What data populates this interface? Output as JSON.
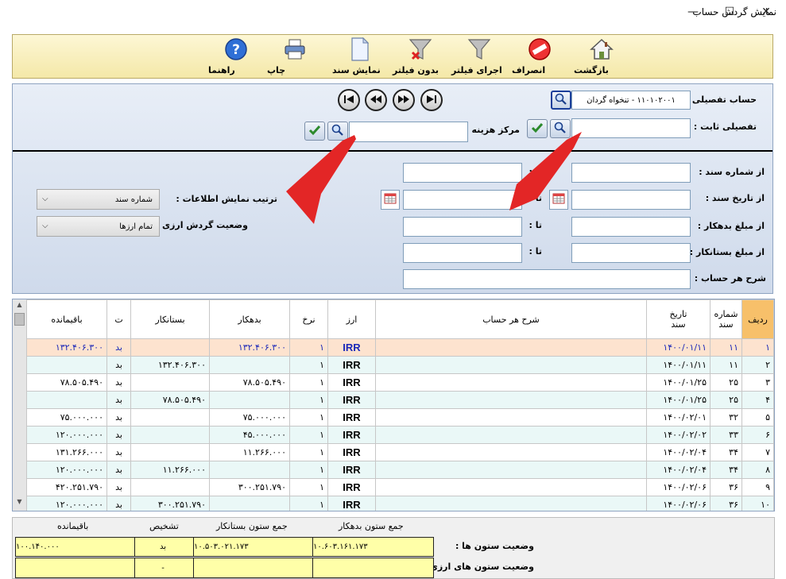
{
  "window": {
    "title": "نمایش گردش حساب",
    "minimize": "—",
    "maximize": "☐",
    "close": "✕"
  },
  "toolbar": {
    "back": "بازگشت",
    "cancel": "انصراف",
    "apply_filter": "اجرای فیلتر",
    "no_filter": "بدون فیلتر",
    "show_doc": "نمایش سند",
    "print": "چاپ",
    "help": "راهنما"
  },
  "filter": {
    "detail_account_label": "حساب تفصیلی :",
    "detail_account_value": "۱۱۰۱۰۲۰۰۱ - تنخواه گردان",
    "fixed_detail_label": "تفصیلی ثابت :",
    "fixed_detail_value": "",
    "cost_center_label": "مرکز هزینه :",
    "cost_center_value": "",
    "from_doc_no_label": "از شماره سند :",
    "from_doc_date_label": "از تاریخ سند :",
    "from_debit_label": "از مبلغ بدهکار :",
    "from_credit_label": "از مبلغ بستانکار :",
    "description_label": "شرح هر حساب :",
    "to_label": "تا :",
    "display_order_label": "ترتیب نمایش اطلاعات :",
    "display_order_value": "شماره سند",
    "currency_status_label": "وضعیت گردش ارزی :",
    "currency_status_value": "تمام ارزها"
  },
  "grid": {
    "headers": {
      "row": "ردیف",
      "doc_no_1": "شماره",
      "doc_no_2": "سند",
      "doc_date_1": "تاریخ",
      "doc_date_2": "سند",
      "description": "شرح هر حساب",
      "currency": "ارز",
      "rate": "نرخ",
      "debit": "بدهکار",
      "credit": "بستانکار",
      "diagnosis": "ت",
      "balance": "باقیمانده"
    },
    "rows": [
      {
        "row": "۱",
        "doc_no": "۱۱",
        "date": "۱۴۰۰/۰۱/۱۱",
        "desc": "",
        "currency": "IRR",
        "rate": "۱",
        "debit": "۱۳۲.۴۰۶.۳۰۰",
        "credit": "",
        "diag": "بد",
        "balance": "۱۳۲.۴۰۶.۳۰۰"
      },
      {
        "row": "۲",
        "doc_no": "۱۱",
        "date": "۱۴۰۰/۰۱/۱۱",
        "desc": "",
        "currency": "IRR",
        "rate": "۱",
        "debit": "",
        "credit": "۱۳۲.۴۰۶.۳۰۰",
        "diag": "بد",
        "balance": ""
      },
      {
        "row": "۳",
        "doc_no": "۲۵",
        "date": "۱۴۰۰/۰۱/۲۵",
        "desc": "",
        "currency": "IRR",
        "rate": "۱",
        "debit": "۷۸.۵۰۵.۴۹۰",
        "credit": "",
        "diag": "بد",
        "balance": "۷۸.۵۰۵.۴۹۰"
      },
      {
        "row": "۴",
        "doc_no": "۲۵",
        "date": "۱۴۰۰/۰۱/۲۵",
        "desc": "",
        "currency": "IRR",
        "rate": "۱",
        "debit": "",
        "credit": "۷۸.۵۰۵.۴۹۰",
        "diag": "بد",
        "balance": ""
      },
      {
        "row": "۵",
        "doc_no": "۳۲",
        "date": "۱۴۰۰/۰۲/۰۱",
        "desc": "",
        "currency": "IRR",
        "rate": "۱",
        "debit": "۷۵.۰۰۰.۰۰۰",
        "credit": "",
        "diag": "بد",
        "balance": "۷۵.۰۰۰.۰۰۰"
      },
      {
        "row": "۶",
        "doc_no": "۳۳",
        "date": "۱۴۰۰/۰۲/۰۲",
        "desc": "",
        "currency": "IRR",
        "rate": "۱",
        "debit": "۴۵.۰۰۰.۰۰۰",
        "credit": "",
        "diag": "بد",
        "balance": "۱۲۰.۰۰۰.۰۰۰"
      },
      {
        "row": "۷",
        "doc_no": "۳۴",
        "date": "۱۴۰۰/۰۲/۰۴",
        "desc": "",
        "currency": "IRR",
        "rate": "۱",
        "debit": "۱۱.۲۶۶.۰۰۰",
        "credit": "",
        "diag": "بد",
        "balance": "۱۳۱.۲۶۶.۰۰۰"
      },
      {
        "row": "۸",
        "doc_no": "۳۴",
        "date": "۱۴۰۰/۰۲/۰۴",
        "desc": "",
        "currency": "IRR",
        "rate": "۱",
        "debit": "",
        "credit": "۱۱.۲۶۶.۰۰۰",
        "diag": "بد",
        "balance": "۱۲۰.۰۰۰.۰۰۰"
      },
      {
        "row": "۹",
        "doc_no": "۳۶",
        "date": "۱۴۰۰/۰۲/۰۶",
        "desc": "",
        "currency": "IRR",
        "rate": "۱",
        "debit": "۳۰۰.۲۵۱.۷۹۰",
        "credit": "",
        "diag": "بد",
        "balance": "۴۲۰.۲۵۱.۷۹۰"
      },
      {
        "row": "۱۰",
        "doc_no": "۳۶",
        "date": "۱۴۰۰/۰۲/۰۶",
        "desc": "",
        "currency": "IRR",
        "rate": "۱",
        "debit": "",
        "credit": "۳۰۰.۲۵۱.۷۹۰",
        "diag": "بد",
        "balance": "۱۲۰.۰۰۰.۰۰۰"
      }
    ]
  },
  "summary": {
    "hdr_debit_sum": "جمع ستون بدهکار",
    "hdr_credit_sum": "جمع ستون بستانکار",
    "hdr_diagnosis": "تشخیص",
    "hdr_balance": "باقیمانده",
    "columns_status_label": "وضعیت ستون ها :",
    "currency_columns_status_label": "وضعیت ستون های ارزی :",
    "debit_sum": "۱۰.۶۰۳.۱۶۱.۱۷۳",
    "credit_sum": "۱۰.۵۰۳.۰۲۱.۱۷۳",
    "diagnosis": "بد",
    "balance": "۱۰۰.۱۴۰.۰۰۰",
    "currency_debit_sum": "",
    "currency_credit_sum": "",
    "currency_diagnosis": "-",
    "currency_balance": ""
  }
}
